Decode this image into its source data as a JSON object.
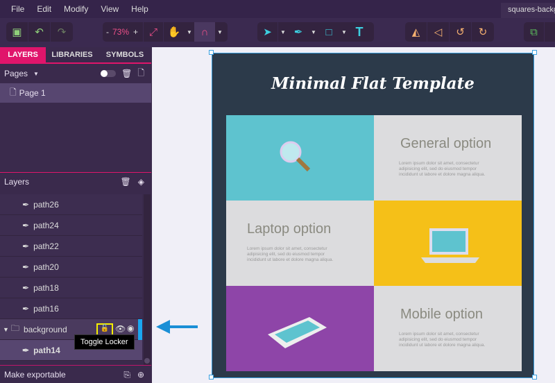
{
  "menu": [
    "File",
    "Edit",
    "Modify",
    "View",
    "Help"
  ],
  "document_tab": "squares-background",
  "toolbar": {
    "zoom_minus": "-",
    "zoom": "73%",
    "zoom_plus": "+"
  },
  "tabs": [
    "LAYERS",
    "LIBRARIES",
    "SYMBOLS"
  ],
  "pages": {
    "label": "Pages",
    "items": [
      "Page 1"
    ]
  },
  "layers": {
    "label": "Layers",
    "items": [
      "path26",
      "path24",
      "path22",
      "path20",
      "path18",
      "path16"
    ],
    "group": "background",
    "child": "path14"
  },
  "tooltip": "Toggle Locker",
  "bottom": {
    "label": "Make exportable"
  },
  "artboard": {
    "title": "Minimal Flat Template",
    "general": "General option",
    "laptop": "Laptop option",
    "mobile": "Mobile option",
    "lorem": "Lorem ipsum dolor sit amet, consectetur adipisicing elit, sed do eiusmod tempor incididunt ut labore et dolore magna aliqua."
  },
  "colors": {
    "accent": "#e0156b",
    "cyan": "#5ec3cf",
    "yellow": "#f5c018",
    "purple": "#8e45a8",
    "arrow": "#1a8fd6"
  }
}
